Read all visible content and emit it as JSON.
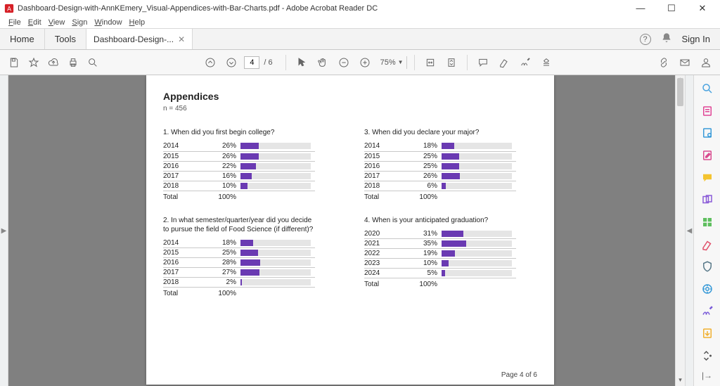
{
  "window": {
    "title": "Dashboard-Design-with-AnnKEmery_Visual-Appendices-with-Bar-Charts.pdf - Adobe Acrobat Reader DC"
  },
  "menu": {
    "file": "File",
    "edit": "Edit",
    "view": "View",
    "sign": "Sign",
    "window": "Window",
    "help": "Help"
  },
  "toprow": {
    "home": "Home",
    "tools": "Tools",
    "tab_label": "Dashboard-Design-...",
    "sign_in": "Sign In"
  },
  "toolbar": {
    "page_current": "4",
    "page_total": "/ 6",
    "zoom": "75%"
  },
  "page": {
    "heading": "Appendices",
    "subheading": "n = 456",
    "footer": "Page 4 of 6"
  },
  "chart_data": [
    {
      "type": "bar",
      "title": "1. When did you first begin college?",
      "categories": [
        "2014",
        "2015",
        "2016",
        "2017",
        "2018"
      ],
      "values": [
        26,
        26,
        22,
        16,
        10
      ],
      "total_label": "Total",
      "total_value": "100%",
      "unit": "%",
      "xlim": [
        0,
        100
      ]
    },
    {
      "type": "bar",
      "title": "3. When did you declare your major?",
      "categories": [
        "2014",
        "2015",
        "2016",
        "2017",
        "2018"
      ],
      "values": [
        18,
        25,
        25,
        26,
        6
      ],
      "total_label": "Total",
      "total_value": "100%",
      "unit": "%",
      "xlim": [
        0,
        100
      ]
    },
    {
      "type": "bar",
      "title": "2. In what semester/quarter/year did you decide to pursue the field of Food Science (if different)?",
      "categories": [
        "2014",
        "2015",
        "2016",
        "2017",
        "2018"
      ],
      "values": [
        18,
        25,
        28,
        27,
        2
      ],
      "total_label": "Total",
      "total_value": "100%",
      "unit": "%",
      "xlim": [
        0,
        100
      ]
    },
    {
      "type": "bar",
      "title": "4. When is your anticipated graduation?",
      "categories": [
        "2020",
        "2021",
        "2022",
        "2023",
        "2024"
      ],
      "values": [
        31,
        35,
        19,
        10,
        5
      ],
      "total_label": "Total",
      "total_value": "100%",
      "unit": "%",
      "xlim": [
        0,
        100
      ]
    }
  ]
}
